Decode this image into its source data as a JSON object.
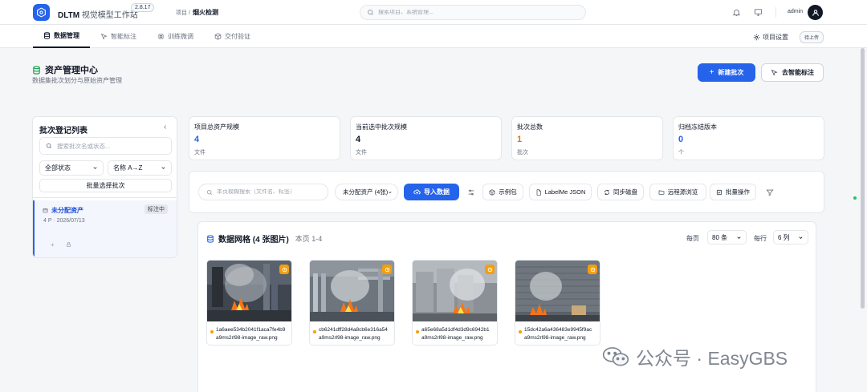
{
  "header": {
    "app_name": "DLTM",
    "app_subtitle": "视觉模型工作站",
    "version": "2.8.17",
    "breadcrumb_label": "项目 /",
    "project_name": "烟火检测",
    "search_placeholder": "搜索项目、系统管理...",
    "user_name": "admin"
  },
  "tabs": [
    {
      "label": "数据管理",
      "icon": "database-icon",
      "active": true
    },
    {
      "label": "智能标注",
      "icon": "cursor-icon",
      "active": false
    },
    {
      "label": "训练微调",
      "icon": "chip-icon",
      "active": false
    },
    {
      "label": "交付验证",
      "icon": "cube-icon",
      "active": false
    }
  ],
  "project_settings_label": "项目设置",
  "pending_badge": "待上传",
  "page": {
    "title": "资产管理中心",
    "subtitle": "数据集批次划分与原始资产管理",
    "new_batch_label": "新建批次",
    "smart_label_btn": "去智能标注"
  },
  "left_panel": {
    "title": "批次登记列表",
    "search_placeholder": "搜索批次名或状态...",
    "status_filter": "全部状态",
    "sort": "名称 A→Z",
    "batch_select_label": "批量选择批次",
    "batches": [
      {
        "name": "未分配资产",
        "status": "标注中",
        "meta": "4 P · 2026/07/13"
      }
    ]
  },
  "stats": [
    {
      "label": "项目总资产规模",
      "value": "4",
      "unit": "文件",
      "color": "#2563eb"
    },
    {
      "label": "当前选中批次规模",
      "value": "4",
      "unit": "文件",
      "color": "#111827"
    },
    {
      "label": "批次总数",
      "value": "1",
      "unit": "批次",
      "color": "#d97706"
    },
    {
      "label": "归档冻结版本",
      "value": "0",
      "unit": "个",
      "color": "#2563eb"
    }
  ],
  "toolbar": {
    "search_placeholder": "本页模糊搜索（文件名、标签）",
    "asset_filter": "未分配资产 (4张)",
    "import_label": "导入数据",
    "buttons": [
      "示例包",
      "LabelMe JSON",
      "同步磁盘",
      "远程源浏览",
      "批量操作"
    ]
  },
  "grid": {
    "title": "数据网格 (4 张图片)",
    "page_info": "本页 1-4",
    "per_page_label": "每页",
    "per_page": "80 条",
    "per_row_label": "每行",
    "per_row": "6 列",
    "images": [
      {
        "name_line1": "1a6aee534b2041f1aca7fe4b9",
        "name_line2": "a9ms2rl98-image_raw.png"
      },
      {
        "name_line1": "cb6241dff28d4a8cb6e316a54",
        "name_line2": "a9ms2rl98-image_raw.png"
      },
      {
        "name_line1": "a65e68a5d1df4d3d9c6942b1",
        "name_line2": "a9ms2rl98-image_raw.png"
      },
      {
        "name_line1": "15dc42a6a436483e9945f9ac",
        "name_line2": "a9ms2rl98-image_raw.png"
      }
    ]
  },
  "watermark": "公众号 · EasyGBS",
  "colors": {
    "primary": "#2563eb",
    "warning": "#f59e0b",
    "text": "#111827"
  }
}
